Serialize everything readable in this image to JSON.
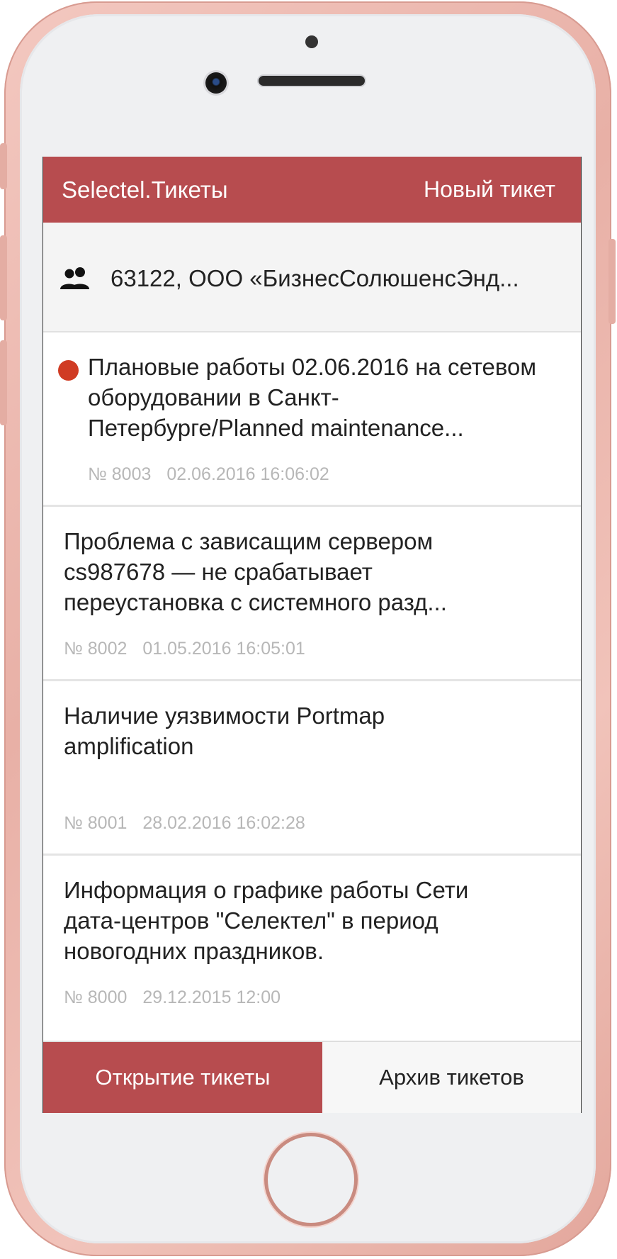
{
  "app": {
    "title": "Selectel.Тикеты",
    "new_ticket_label": "Новый тикет",
    "accent_color": "#b74c4f",
    "unread_color": "#d03b23"
  },
  "account": {
    "icon": "users-icon",
    "label": "63122, ООО «БизнесСолюшенсЭнд..."
  },
  "tickets": [
    {
      "title": "Плановые работы 02.06.2016 на сетевом оборудовании в Санкт-Петербурге/Planned maintenance...",
      "number": "№ 8003",
      "date": "02.06.2016 16:06:02",
      "unread": true
    },
    {
      "title": "Проблема с зависащим сервером cs987678 — не срабатывает переустановка с системного разд...",
      "number": "№ 8002",
      "date": "01.05.2016 16:05:01",
      "unread": false
    },
    {
      "title": "Наличие уязвимости Portmap amplification",
      "number": "№ 8001",
      "date": "28.02.2016 16:02:28",
      "unread": false
    },
    {
      "title": "Информация о графике работы Сети дата-центров \"Селектел\" в период новогодних праздников.",
      "number": "№ 8000",
      "date": "29.12.2015 12:00",
      "unread": false
    }
  ],
  "tabs": {
    "open_label": "Открытие тикеты",
    "archive_label": "Архив тикетов"
  }
}
